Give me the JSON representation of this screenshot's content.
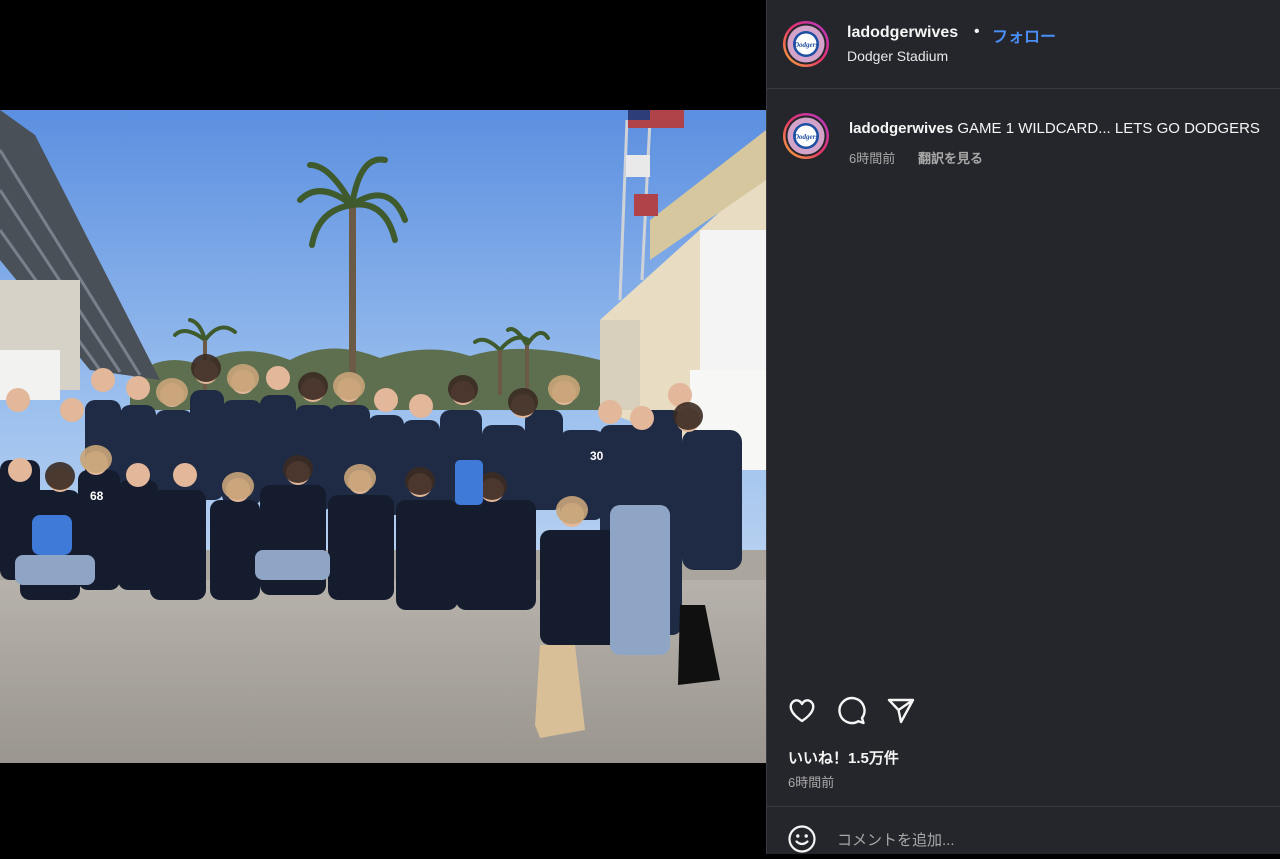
{
  "post": {
    "username": "ladodgerwives",
    "dot": "•",
    "follow_label": "フォロー",
    "location": "Dodger Stadium",
    "avatar_icon": "dodgers-logo-avatar-icon",
    "accent_color": "#4a8ff7",
    "panel_color": "#25262b"
  },
  "caption": {
    "username": "ladodgerwives",
    "text": "GAME 1 WILDCARD... LETS GO DODGERS",
    "time": "6時間前",
    "translate_label": "翻訳を見る"
  },
  "actions": {
    "like_icon": "heart-icon",
    "comment_icon": "comment-bubble-icon",
    "share_icon": "paper-plane-icon"
  },
  "likes_text": "いいね！1.5万件",
  "post_time": "6時間前",
  "add_comment": {
    "emoji_icon": "smiley-icon",
    "placeholder": "コメントを追加..."
  },
  "logo": {
    "text": "Dodgers"
  }
}
